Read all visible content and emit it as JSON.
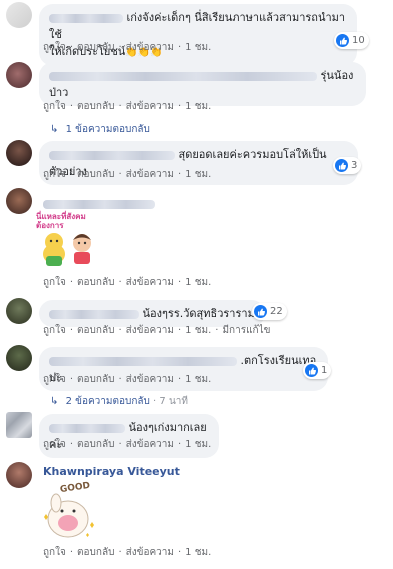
{
  "actions": {
    "like": "ถูกใจ",
    "reply": "ตอบกลับ",
    "send": "ส่งข้อความ",
    "dot": "·"
  },
  "colors": {
    "link": "#385898",
    "like_badge": "#1877f2",
    "bubble": "#f0f2f5",
    "meta": "#65676b"
  },
  "comments": [
    {
      "line1": "เก่งจังค่ะเด็กๆ นี่สิเรียนภาษาแล้วสามารถนำมาใช้",
      "line2": "ให้เกิดประโยชน์",
      "emoji": "👏👏👏",
      "likes": "10",
      "time": "1 ชม."
    },
    {
      "line1": "รุ่นน้อง",
      "line2": "ป่าว",
      "time": "1 ชม.",
      "replies": "1 ข้อความตอบกลับ"
    },
    {
      "text": "สุดยอดเลยค่ะควรมอบโล่ให้เป็นตัวอย่าง",
      "likes": "3",
      "time": "1 ชม."
    },
    {
      "sticker_text": "นี่แหละที่สังคมต้องการ",
      "time": "1 ชม."
    },
    {
      "text": "น้องๆรร.วัดสุทธิวราราม",
      "likes": "22",
      "time": "1 ชม.",
      "edited": "มีการแก้ไข"
    },
    {
      "text": ".ตกโรงเรียนเทอปะ",
      "likes": "1",
      "time": "1 ชม.",
      "replies": "2 ข้อความตอบกลับ",
      "replies_time": "7 นาที"
    },
    {
      "text": "น้องๆเก่งมากเลยค่ะ",
      "time": "1 ชม."
    },
    {
      "author": "Khawnpiraya Viteeyut",
      "sticker_text": "GOOD",
      "time": "1 ชม."
    }
  ],
  "icons": [
    "like-thumb-icon",
    "reply-arrow-icon",
    "sticker-image"
  ]
}
